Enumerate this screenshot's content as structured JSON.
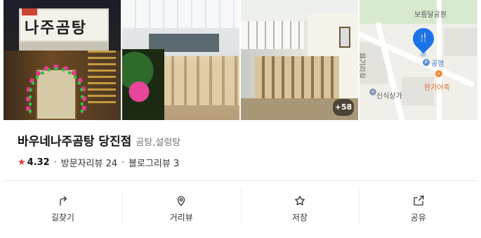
{
  "gallery": {
    "photo1_sign": "나주곰탕",
    "more_count": "+58"
  },
  "map": {
    "labels": {
      "park": "보름달공원",
      "road": "읍기리길",
      "place": "공영",
      "restaurant": "한가어죽",
      "mall": "신식상가"
    }
  },
  "place": {
    "name": "바우네나주곰탕 당진점",
    "category": "곰탕,설렁탕",
    "rating": "4.32",
    "visitor_reviews": "방문자리뷰 24",
    "blog_reviews": "블로그리뷰 3"
  },
  "actions": [
    {
      "label": "길찾기",
      "icon": "directions-icon"
    },
    {
      "label": "거리뷰",
      "icon": "street-view-icon"
    },
    {
      "label": "저장",
      "icon": "star-icon"
    },
    {
      "label": "공유",
      "icon": "share-icon"
    }
  ],
  "colors": {
    "star": "#e8333b",
    "pin": "#1a73e8"
  }
}
